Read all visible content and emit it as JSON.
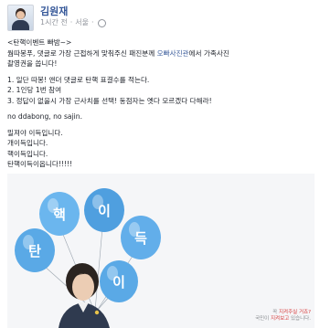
{
  "post": {
    "author": "김원재",
    "time": "1시간 전",
    "location": "서울",
    "separator": "·",
    "globe_icon": "globe-icon",
    "body": {
      "event_title": "<탄핵이벤트 빠밤~>",
      "intro_line1_pre": "웜따봉푸, 댓글로 가장 근접하게 맞춰주신 패진분께 ",
      "intro_line1_link": "오빠사진관",
      "intro_line1_post": "에서 가족사진",
      "intro_line2": "촬영권을 쏩니다!",
      "rules": [
        "1. 일단 따봉! 앤더 댓글로 탄핵 표결수를 적는다.",
        "2. 1인당 1번 참여",
        "3. 정답이 없을시 가장 근사치를 선택! 동점자는 옛다 모르겠다 다해라!"
      ],
      "no_line": "no ddabong, no sajin.",
      "closing": [
        "밀져야 이득입니다.",
        "개이득입니다.",
        "핵이득입니다.",
        "탄핵이득이옵니다!!!!!"
      ]
    },
    "image": {
      "balloons": [
        "탄",
        "핵",
        "이",
        "득",
        "이"
      ],
      "balloon_color": "#5aa9e6",
      "caption_line1_pre": "꼭 ",
      "caption_line1_hl": "지켜주실 거죠?",
      "caption_line2_pre": "국민이 ",
      "caption_line2_hl": "지켜보고",
      "caption_line2_post": " 있습니다."
    }
  }
}
